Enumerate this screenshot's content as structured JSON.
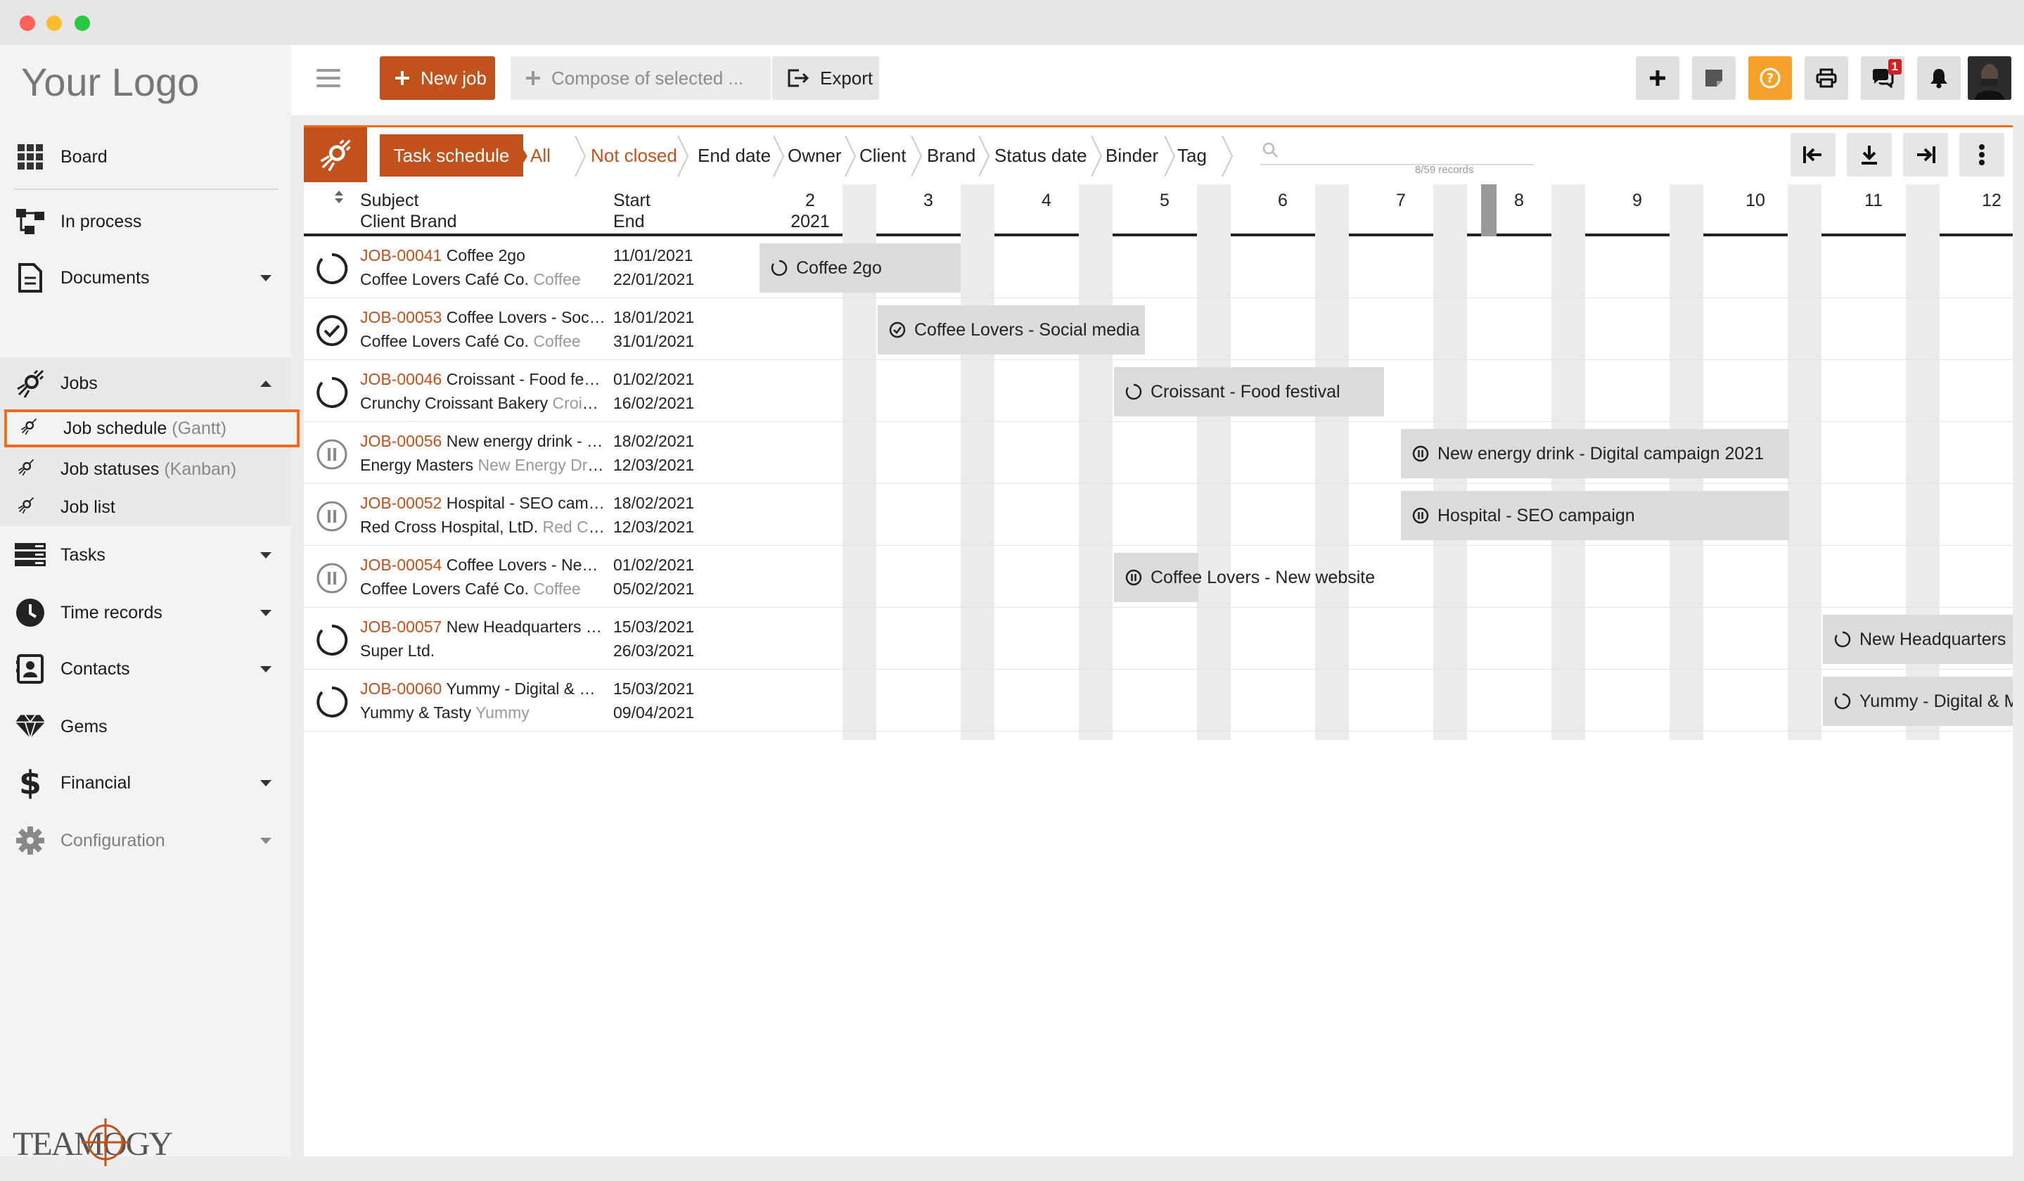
{
  "sidebar": {
    "logo": "Your Logo",
    "items": [
      {
        "label": "Board",
        "icon": "grid-icon"
      },
      {
        "label": "In process",
        "icon": "process-icon"
      },
      {
        "label": "Documents",
        "icon": "document-icon"
      },
      {
        "label": "Jobs",
        "icon": "rocket-icon"
      },
      {
        "label": "Tasks",
        "icon": "tasks-icon"
      },
      {
        "label": "Time records",
        "icon": "clock-icon"
      },
      {
        "label": "Contacts",
        "icon": "contacts-icon"
      },
      {
        "label": "Gems",
        "icon": "gem-icon"
      },
      {
        "label": "Financial",
        "icon": "dollar-icon"
      },
      {
        "label": "Configuration",
        "icon": "gear-icon"
      }
    ],
    "jobs_sub": [
      {
        "label": "Job schedule",
        "suffix": "(Gantt)"
      },
      {
        "label": "Job statuses",
        "suffix": "(Kanban)"
      },
      {
        "label": "Job list",
        "suffix": ""
      }
    ],
    "brand_logo_text": "TEAMOGY"
  },
  "topbar": {
    "new_job": "New job",
    "compose": "Compose of selected ...",
    "export": "Export",
    "notification_count": "1"
  },
  "filters": {
    "items": [
      "Task schedule",
      "All",
      "Not closed",
      "End date",
      "Owner",
      "Client",
      "Brand",
      "Status date",
      "Binder",
      "Tag"
    ],
    "records": "8/59 records"
  },
  "columns": {
    "subject": "Subject",
    "client_brand": "Client Brand",
    "start": "Start",
    "end": "End"
  },
  "weeks": [
    "2",
    "3",
    "4",
    "5",
    "6",
    "7",
    "8",
    "9",
    "10",
    "11",
    "12"
  ],
  "year": "2021",
  "jobs": [
    {
      "id": "JOB-00041",
      "name": "Coffee 2go",
      "client": "Coffee Lovers Café Co.",
      "brand": "Coffee",
      "start": "11/01/2021",
      "end": "22/01/2021",
      "status": "open",
      "bar": "Coffee 2go"
    },
    {
      "id": "JOB-00053",
      "name": "Coffee Lovers - Social media",
      "client": "Coffee Lovers Café Co.",
      "brand": "Coffee",
      "start": "18/01/2021",
      "end": "31/01/2021",
      "status": "done",
      "bar": "Coffee Lovers - Social media"
    },
    {
      "id": "JOB-00046",
      "name": "Croissant - Food festival",
      "client": "Crunchy Croissant Bakery",
      "brand": "Croissant",
      "start": "01/02/2021",
      "end": "16/02/2021",
      "status": "open",
      "bar": "Croissant - Food festival"
    },
    {
      "id": "JOB-00056",
      "name": "New energy drink - Digital campaign 2021",
      "client": "Energy Masters",
      "brand": "New Energy Drink",
      "start": "18/02/2021",
      "end": "12/03/2021",
      "status": "paused",
      "bar": "New energy drink - Digital campaign 2021"
    },
    {
      "id": "JOB-00052",
      "name": "Hospital - SEO campaign",
      "client": "Red Cross Hospital, LtD.",
      "brand": "Red Cross",
      "start": "18/02/2021",
      "end": "12/03/2021",
      "status": "paused",
      "bar": "Hospital - SEO campaign"
    },
    {
      "id": "JOB-00054",
      "name": "Coffee Lovers - New website",
      "client": "Coffee Lovers Café Co.",
      "brand": "Coffee",
      "start": "01/02/2021",
      "end": "05/02/2021",
      "status": "paused",
      "bar": "Coffee Lovers - New website"
    },
    {
      "id": "JOB-00057",
      "name": "New Headquarters - Super Ltd.",
      "client": "Super Ltd.",
      "brand": "",
      "start": "15/03/2021",
      "end": "26/03/2021",
      "status": "open",
      "bar": "New Headquarters"
    },
    {
      "id": "JOB-00060",
      "name": "Yummy - Digital & Marketing",
      "client": "Yummy & Tasty",
      "brand": "Yummy",
      "start": "15/03/2021",
      "end": "09/04/2021",
      "status": "open",
      "bar": "Yummy - Digital & Marketing"
    }
  ]
}
